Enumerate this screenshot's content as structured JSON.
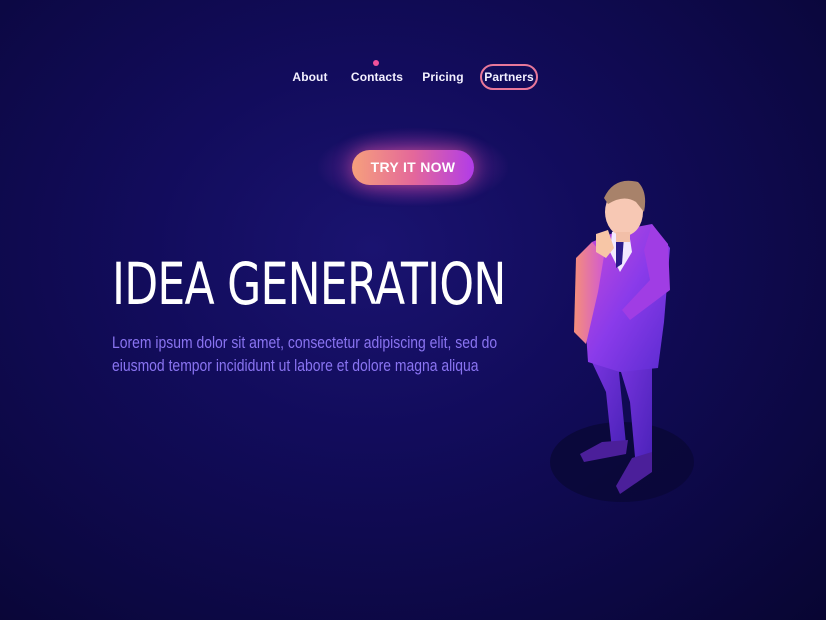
{
  "nav": {
    "items": [
      {
        "label": "About"
      },
      {
        "label": "Contacts"
      },
      {
        "label": "Pricing"
      },
      {
        "label": "Partners"
      }
    ],
    "active": "Partners",
    "indicator_on": "Contacts"
  },
  "cta": {
    "label": "TRY IT NOW"
  },
  "hero": {
    "title": "IDEA GENERATION",
    "description": "Lorem ipsum dolor sit amet, consectetur adipiscing elit, sed do eiusmod tempor incididunt ut labore et dolore magna aliqua"
  },
  "colors": {
    "background": "#120c5c",
    "accent_pink": "#e4689a",
    "accent_purple": "#b13ce8",
    "text_secondary": "#8a74f2"
  }
}
